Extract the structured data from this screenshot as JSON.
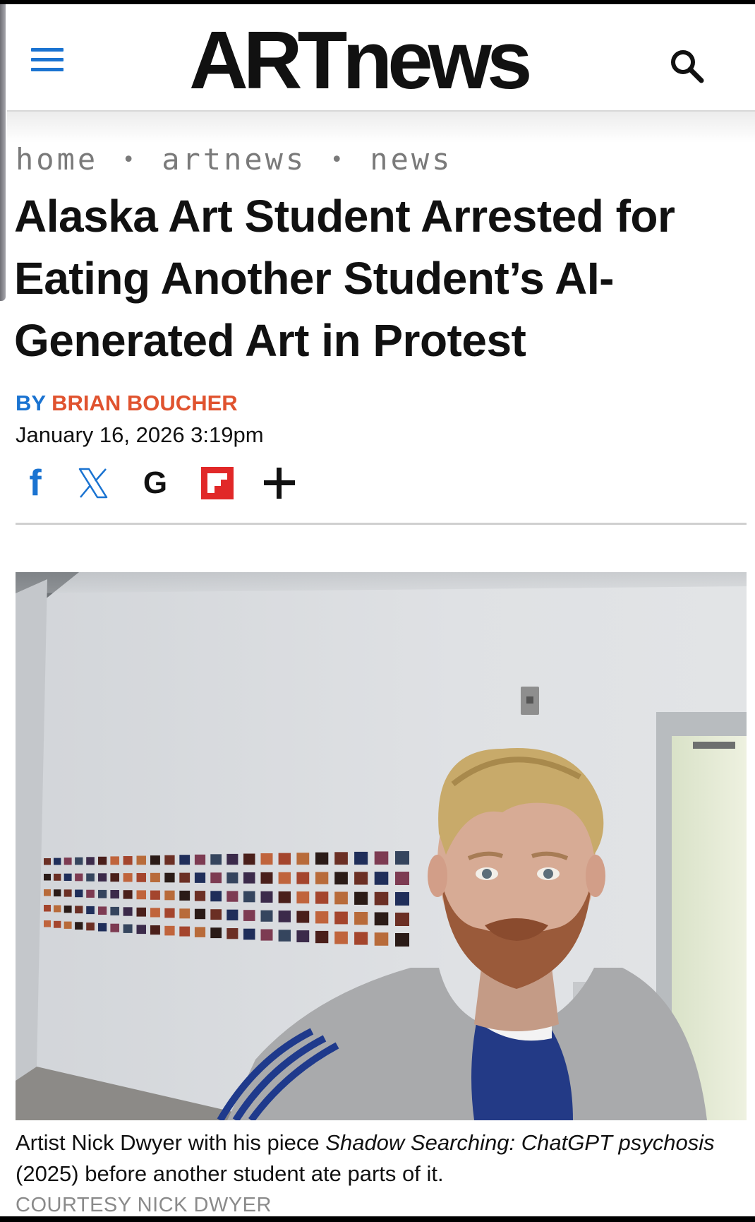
{
  "header": {
    "logo_text": "ARTnews",
    "menu_icon": "hamburger-menu-icon",
    "search_icon": "search-icon",
    "accent_color": "#1a73d1"
  },
  "breadcrumb": {
    "items": [
      "home",
      "artnews",
      "news"
    ],
    "separator": "•"
  },
  "article": {
    "headline": "Alaska Art Student Arrested for Eating Another Student’s AI-Generated Art in Protest",
    "byline_prefix": "BY",
    "author": "BRIAN BOUCHER",
    "author_color": "#e0532f",
    "date": "January 16, 2026 3:19pm"
  },
  "share": {
    "icons": [
      "facebook-icon",
      "x-icon",
      "google-icon",
      "flipboard-icon",
      "plus-icon"
    ],
    "facebook_glyph": "f",
    "google_glyph": "G"
  },
  "photo": {
    "caption_part1": "Artist Nick Dwyer with his piece ",
    "caption_italic": "Shadow Searching: ChatGPT psychosis",
    "caption_part2": " (2025) before another student ate parts of it.",
    "credit": "COURTESY NICK DWYER"
  }
}
